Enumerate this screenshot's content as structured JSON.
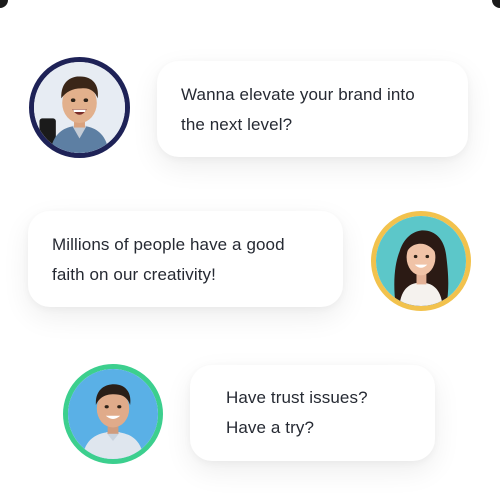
{
  "messages": [
    {
      "lines": [
        "Wanna elevate your brand into",
        "the next level?"
      ],
      "avatar": "smiling-man-avatar",
      "ring_color": "#1e2257",
      "side": "left"
    },
    {
      "lines": [
        "Millions of people have a good",
        "faith on our creativity!"
      ],
      "avatar": "smiling-woman-avatar",
      "ring_color": "#f2c24d",
      "side": "right"
    },
    {
      "lines": [
        "Have trust issues?",
        "Have a try?"
      ],
      "avatar": "smiling-man-avatar",
      "ring_color": "#3ccf8e",
      "side": "left"
    }
  ]
}
